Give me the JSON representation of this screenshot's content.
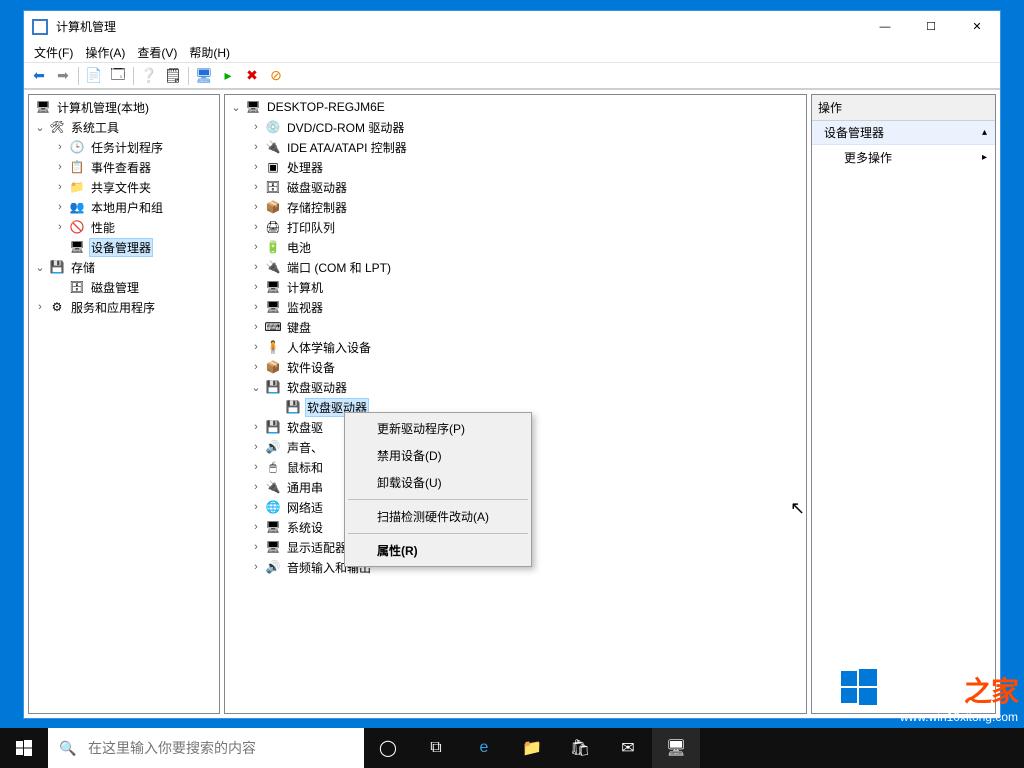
{
  "window": {
    "title": "计算机管理"
  },
  "menu": {
    "file": "文件(F)",
    "action": "操作(A)",
    "view": "查看(V)",
    "help": "帮助(H)"
  },
  "left": {
    "root": "计算机管理(本地)",
    "sys": "系统工具",
    "sched": "任务计划程序",
    "event": "事件查看器",
    "share": "共享文件夹",
    "users": "本地用户和组",
    "perf": "性能",
    "devmgr": "设备管理器",
    "storage": "存储",
    "disk": "磁盘管理",
    "svc": "服务和应用程序"
  },
  "mid": {
    "host": "DESKTOP-REGJM6E",
    "dvd": "DVD/CD-ROM 驱动器",
    "ide": "IDE ATA/ATAPI 控制器",
    "cpu": "处理器",
    "diskdrv": "磁盘驱动器",
    "storctrl": "存储控制器",
    "printq": "打印队列",
    "battery": "电池",
    "ports": "端口 (COM 和 LPT)",
    "computer": "计算机",
    "monitor": "监视器",
    "keyboard": "键盘",
    "hid": "人体学输入设备",
    "softdev": "软件设备",
    "floppydrv": "软盘驱动器",
    "floppydrv_item": "软盘驱动器",
    "floppyctrl": "软盘驱",
    "audioctrl": "声音、",
    "mouse": "鼠标和",
    "usb": "通用串",
    "net": "网络适",
    "sysdev": "系统设",
    "display": "显示适配器",
    "audioio": "音频输入和输出"
  },
  "ctx": {
    "update": "更新驱动程序(P)",
    "disable": "禁用设备(D)",
    "uninstall": "卸载设备(U)",
    "scan": "扫描检测硬件改动(A)",
    "props": "属性(R)"
  },
  "right": {
    "header": "操作",
    "section": "设备管理器",
    "more": "更多操作"
  },
  "taskbar": {
    "search_placeholder": "在这里输入你要搜索的内容"
  },
  "watermark": {
    "brand": "Win10",
    "suffix": "之家",
    "url": "www.win10xitong.com"
  }
}
